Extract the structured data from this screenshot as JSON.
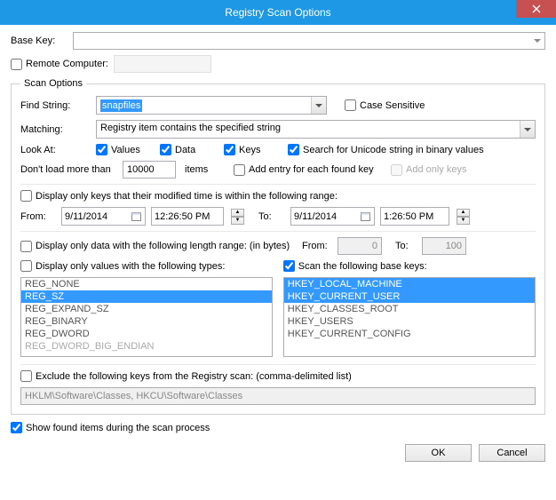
{
  "title": "Registry Scan Options",
  "baseKey": {
    "label": "Base Key:"
  },
  "remoteComputer": {
    "label": "Remote Computer:",
    "checked": false
  },
  "scanOptions": {
    "legend": "Scan Options",
    "findString": {
      "label": "Find String:",
      "value": "snapfiles"
    },
    "caseSensitive": {
      "label": "Case Sensitive",
      "checked": false
    },
    "matching": {
      "label": "Matching:",
      "value": "Registry item contains the specified string"
    },
    "lookAt": {
      "label": "Look At:",
      "values": {
        "label": "Values",
        "checked": true
      },
      "data": {
        "label": "Data",
        "checked": true
      },
      "keys": {
        "label": "Keys",
        "checked": true
      },
      "unicode": {
        "label": "Search for Unicode string in binary values",
        "checked": true
      }
    },
    "dontLoad": {
      "label": "Don't load more than",
      "value": "10000",
      "unit": "items"
    },
    "addEntry": {
      "label": "Add entry for each found key",
      "checked": false
    },
    "addOnlyKeys": {
      "label": "Add only keys",
      "checked": false
    },
    "modifiedRange": {
      "label": "Display only keys that their modified time is within the following range:",
      "checked": false,
      "fromLabel": "From:",
      "fromDate": "9/11/2014",
      "fromTime": "12:26:50 PM",
      "toLabel": "To:",
      "toDate": "9/11/2014",
      "toTime": "1:26:50 PM"
    },
    "lengthRange": {
      "label": "Display only data with the following length range: (in bytes)",
      "checked": false,
      "fromLabel": "From:",
      "fromValue": "0",
      "toLabel": "To:",
      "toValue": "100"
    },
    "valueTypes": {
      "label": "Display only values with the following types:",
      "checked": false,
      "items": [
        "REG_NONE",
        "REG_SZ",
        "REG_EXPAND_SZ",
        "REG_BINARY",
        "REG_DWORD",
        "REG_DWORD_BIG_ENDIAN"
      ],
      "selected": [
        1
      ]
    },
    "baseKeys": {
      "label": "Scan the following base keys:",
      "checked": true,
      "items": [
        "HKEY_LOCAL_MACHINE",
        "HKEY_CURRENT_USER",
        "HKEY_CLASSES_ROOT",
        "HKEY_USERS",
        "HKEY_CURRENT_CONFIG"
      ],
      "selected": [
        0,
        1
      ]
    },
    "excludeKeys": {
      "label": "Exclude the following keys from the Registry scan: (comma-delimited list)",
      "checked": false,
      "value": "HKLM\\Software\\Classes, HKCU\\Software\\Classes"
    }
  },
  "showFound": {
    "label": "Show found items during the scan process",
    "checked": true
  },
  "buttons": {
    "ok": "OK",
    "cancel": "Cancel"
  }
}
